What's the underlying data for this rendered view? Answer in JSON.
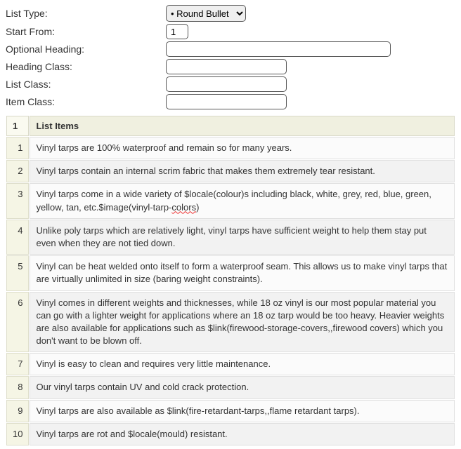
{
  "form": {
    "listType": {
      "label": "List Type:",
      "selected": "• Round Bullet"
    },
    "startFrom": {
      "label": "Start From:",
      "value": "1"
    },
    "optionalHeading": {
      "label": "Optional Heading:",
      "value": ""
    },
    "headingClass": {
      "label": "Heading Class:",
      "value": ""
    },
    "listClass": {
      "label": "List Class:",
      "value": ""
    },
    "itemClass": {
      "label": "Item Class:",
      "value": ""
    }
  },
  "table": {
    "colNum": "1",
    "colHeader": "List Items",
    "rows": [
      {
        "n": "1",
        "text": "Vinyl tarps are 100% waterproof and remain so for many years."
      },
      {
        "n": "2",
        "text": "Vinyl tarps contain an internal scrim fabric that makes them extremely tear resistant."
      },
      {
        "n": "3",
        "text": "Vinyl tarps come in a wide variety of $locale(colour)s including black, white, grey, red, blue, green, yellow, tan, etc.$image(vinyl-tarp-",
        "squiggle": "colors",
        "after": ")"
      },
      {
        "n": "4",
        "text": "Unlike poly tarps which are relatively light, vinyl tarps have sufficient weight to help them stay put even when they are not tied down."
      },
      {
        "n": "5",
        "text": "Vinyl can be heat welded onto itself to form a waterproof seam. This allows us to make vinyl tarps that are virtually unlimited in size (baring weight constraints)."
      },
      {
        "n": "6",
        "text": "Vinyl comes in different weights and thicknesses, while 18 oz vinyl is our most popular material you can go with a lighter weight for applications where an 18 oz tarp would be too heavy. Heavier weights are also available for applications such as $link(firewood-storage-covers,,firewood covers) which you don't want to be blown off."
      },
      {
        "n": "7",
        "text": "Vinyl is easy to clean and requires very little maintenance."
      },
      {
        "n": "8",
        "text": "Our vinyl tarps contain UV and cold crack protection."
      },
      {
        "n": "9",
        "text": "Vinyl tarps are also available as $link(fire-retardant-tarps,,flame retardant tarps)."
      },
      {
        "n": "10",
        "text": "Vinyl tarps are rot and $locale(mould) resistant."
      }
    ]
  }
}
